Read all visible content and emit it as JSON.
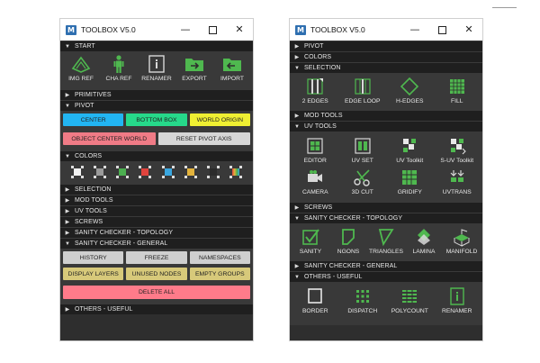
{
  "left": {
    "title": "TOOLBOX V5.0",
    "sections": {
      "start": "START",
      "primitives": "PRIMITIVES",
      "pivot": "PIVOT",
      "colors": "COLORS",
      "selection": "SELECTION",
      "mod_tools": "MOD TOOLS",
      "uv_tools": "UV TOOLS",
      "screws": "SCREWS",
      "sanity_topology": "SANITY CHECKER - TOPOLOGY",
      "sanity_general": "SANITY CHECKER - GENERAL",
      "others": "OTHERS - USEFUL"
    },
    "start_tools": [
      "IMG REF",
      "CHA REF",
      "RENAMER",
      "EXPORT",
      "IMPORT"
    ],
    "pivot_buttons": [
      "CENTER",
      "BOTTOM BOX",
      "WORLD ORIGIN"
    ],
    "pivot_buttons2": [
      "OBJECT CENTER WORLD",
      "RESET PIVOT AXIS"
    ],
    "swatch_colors": [
      "#f2f2f2",
      "#9a9a9a",
      "#4caf50",
      "#e0443e",
      "#3aa7e0",
      "#e2b23c",
      "#2b2b2b",
      "multi"
    ],
    "general_buttons": [
      "HISTORY",
      "FREEZE",
      "NAMESPACES",
      "DISPLAY LAYERS",
      "UNUSED NODES",
      "EMPTY GROUPS"
    ],
    "delete_all": "DELETE ALL"
  },
  "right": {
    "title": "TOOLBOX V5.0",
    "sections": {
      "pivot": "PIVOT",
      "colors": "COLORS",
      "selection": "SELECTION",
      "mod_tools": "MOD TOOLS",
      "uv_tools": "UV TOOLS",
      "screws": "SCREWS",
      "sanity_topology": "SANITY CHECKER - TOPOLOGY",
      "sanity_general": "SANITY CHECKER - GENERAL",
      "others": "OTHERS - USEFUL"
    },
    "selection_tools": [
      "2 EDGES",
      "EDGE LOOP",
      "H-EDGES",
      "FILL"
    ],
    "uv_tools_row1": [
      "EDITOR",
      "UV SET",
      "UV Toolkit",
      "S-UV Toolkit"
    ],
    "uv_tools_row2": [
      "CAMERA",
      "3D CUT",
      "GRIDIFY",
      "UVTRANS"
    ],
    "sanity_tools": [
      "SANITY",
      "NGONS",
      "TRIANGLES",
      "LAMINA",
      "MANIFOLD"
    ],
    "others_tools": [
      "BORDER",
      "DISPATCH",
      "POLYCOUNT",
      "RENAMER"
    ]
  },
  "colors": {
    "accent_green": "#4fb84f",
    "pivot_center": "#22b5f2",
    "pivot_bottom": "#26d98a",
    "pivot_world": "#f0f032",
    "object_center": "#f07b86",
    "reset_pivot": "#d6d6d6",
    "general_btn": "#cfcfcf",
    "general_btn_yellow": "#d7c97a",
    "delete_all": "#ff7b8a"
  }
}
